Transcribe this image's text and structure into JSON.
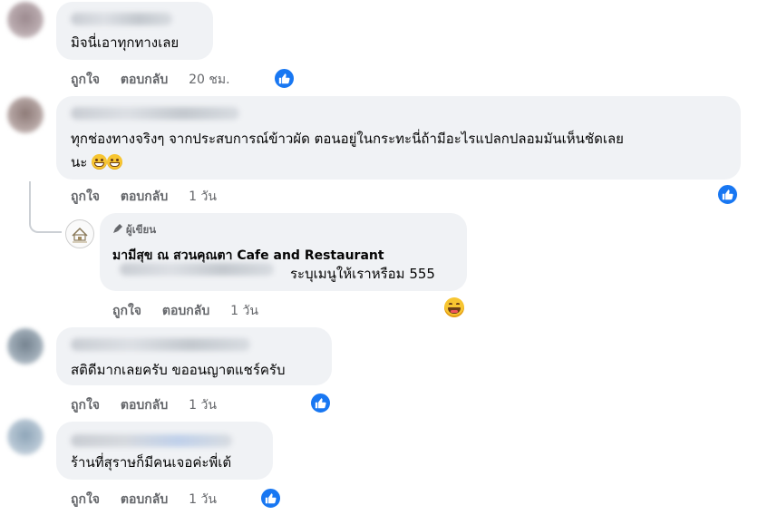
{
  "comments": [
    {
      "text": "มิจนี่เอาทุกทางเลย",
      "actions": {
        "like": "ถูกใจ",
        "reply": "ตอบกลับ",
        "time": "20 ชม."
      }
    },
    {
      "text_line1": "ทุกช่องทางจริงๆ จากประสบการณ์ข้าวผัด ตอนอยู่ในกระทะนี่ถ้ามีอะไรแปลกปลอมมันเห็นชัดเลย",
      "text_line2": "นะ",
      "actions": {
        "like": "ถูกใจ",
        "reply": "ตอบกลับ",
        "time": "1 วัน"
      }
    },
    {
      "author_badge": "ผู้เขียน",
      "page_name": "มามีสุข ณ สวนคุณตา Cafe and Restaurant",
      "text": "ระบุเมนูให้เราหรือม 555",
      "actions": {
        "like": "ถูกใจ",
        "reply": "ตอบกลับ",
        "time": "1 วัน"
      }
    },
    {
      "text": "สติดีมากเลยครับ ขออนญาตแชร์ครับ",
      "actions": {
        "like": "ถูกใจ",
        "reply": "ตอบกลับ",
        "time": "1 วัน"
      }
    },
    {
      "text": "ร้านที่สุราษก็มีคนเจอค่ะพี่เต้",
      "actions": {
        "like": "ถูกใจ",
        "reply": "ตอบกลับ",
        "time": "1 วัน"
      }
    }
  ],
  "icons": {
    "like_reaction": "like-icon",
    "haha_reaction": "haha-icon",
    "grin_emoji": "grinning-emoji",
    "author_badge_icon": "microphone-icon"
  },
  "colors": {
    "accent": "#1877f2",
    "bubble": "#f0f2f5",
    "meta_text": "#65676b"
  }
}
